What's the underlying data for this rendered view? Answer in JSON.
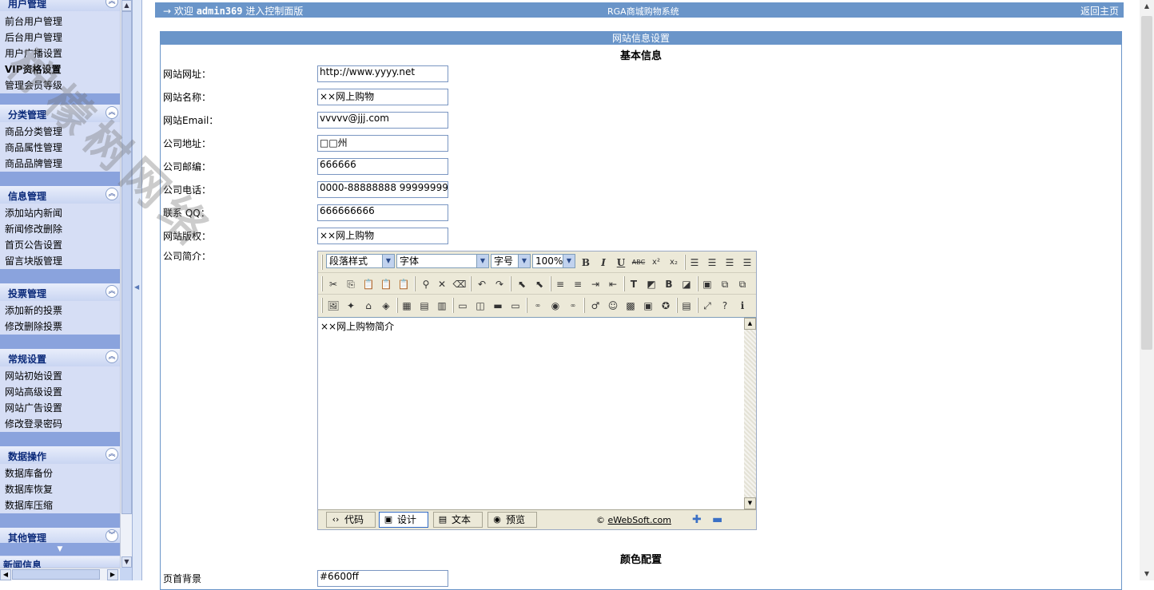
{
  "sidebar": {
    "groups": [
      {
        "title": "用户管理",
        "toggle": "︽",
        "items": [
          "前台用户管理",
          "后台用户管理",
          "用户广播设置",
          "VIP资格设置",
          "管理会员等级"
        ]
      },
      {
        "title": "分类管理",
        "toggle": "︽",
        "items": [
          "商品分类管理",
          "商品属性管理",
          "商品品牌管理"
        ]
      },
      {
        "title": "信息管理",
        "toggle": "︽",
        "items": [
          "添加站内新闻",
          "新闻修改删除",
          "首页公告设置",
          "留言块版管理"
        ]
      },
      {
        "title": "投票管理",
        "toggle": "︽",
        "items": [
          "添加新的投票",
          "修改删除投票"
        ]
      },
      {
        "title": "常规设置",
        "toggle": "︽",
        "items": [
          "网站初始设置",
          "网站高级设置",
          "网站广告设置",
          "修改登录密码"
        ]
      },
      {
        "title": "数据操作",
        "toggle": "︽",
        "items": [
          "数据库备份",
          "数据库恢复",
          "数据库压缩"
        ]
      },
      {
        "title": "其他管理",
        "toggle": "︾",
        "items": []
      }
    ],
    "bottom_group_title": "新闻信息"
  },
  "topbar": {
    "welcome_prefix": "→ 欢迎",
    "username": "admin369",
    "welcome_suffix": "进入控制面版",
    "system_name": "RGA商城购物系统",
    "home_link": "返回主页"
  },
  "panel": {
    "title": "网站信息设置",
    "basic_section": "基本信息",
    "color_section": "颜色配置"
  },
  "fields": {
    "site_url": {
      "label": "网站网址：",
      "value": "http://www.yyyy.net"
    },
    "site_name": {
      "label": "网站名称：",
      "value": "××网上购物"
    },
    "site_email": {
      "label": "网站Email：",
      "value": "vvvvv@jjj.com"
    },
    "address": {
      "label": "公司地址：",
      "value": "□□州"
    },
    "postcode": {
      "label": "公司邮编：",
      "value": "666666"
    },
    "phone": {
      "label": "公司电话：",
      "value": "0000-88888888  9999999999"
    },
    "qq": {
      "label": "联系 QQ：",
      "value": "666666666"
    },
    "copyright": {
      "label": "网站版权：",
      "value": "××网上购物"
    },
    "intro": {
      "label": "公司简介："
    },
    "top_bg": {
      "label": "页首背景",
      "value": "#6600ff"
    }
  },
  "editor": {
    "paragraph_style": "段落样式",
    "font": "字体",
    "font_size": "字号",
    "zoom": "100%",
    "content": "××网上购物简介",
    "modes": [
      "代码",
      "设计",
      "文本",
      "预览"
    ],
    "credit_prefix": "©",
    "credit_link": "eWebSoft.com"
  },
  "watermark": "柠檬树网络"
}
